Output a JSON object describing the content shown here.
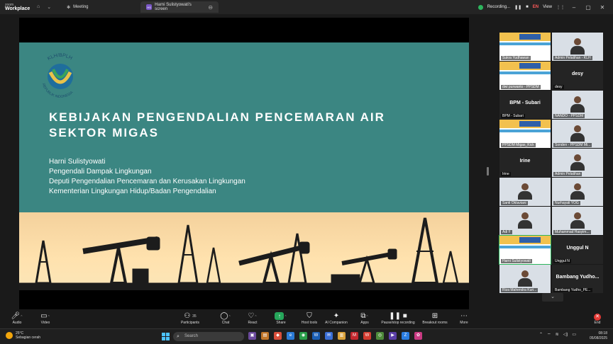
{
  "titlebar": {
    "brand_top": "zoom",
    "brand_bottom": "Workplace",
    "meeting_tab": "Meeting",
    "screen_tab": "Harni Sulistyowati's screen",
    "screen_tab_initials": "HS",
    "recording": "Recording...",
    "lang": "EN",
    "view": "View"
  },
  "slide": {
    "logo_text": "KLH/BPLH",
    "logo_subtext": "REPUBLIK INDONESIA",
    "title_line1": "KEBIJAKAN PENGENDALIAN PENCEMARAN AIR",
    "title_line2": "SEKTOR MIGAS",
    "lines": [
      "Harni Sulistyowati",
      "Pengendali Dampak Lingkungan",
      "Deputi Pengendalian Pencemaran dan Kerusakan Lingkungan",
      "Kementerian Lingkungan Hidup/Badan Pengendalian"
    ]
  },
  "participants": [
    {
      "name": "Sukra Yudhawan"
    },
    {
      "name": "Admin Pelatihan - KLH"
    },
    {
      "name": "dwi purwanto - PPSDM"
    },
    {
      "name": "desy",
      "big": "desy"
    },
    {
      "name": "BPM - Subari",
      "big": "BPM - Subari"
    },
    {
      "name": "NANDO - PPSDM"
    },
    {
      "name": "PPSDM Migas_Kick"
    },
    {
      "name": "Sonden - PPSDM Mi..."
    },
    {
      "name": "Irine",
      "big": "Irine"
    },
    {
      "name": "Admin Pelatihan"
    },
    {
      "name": "Santi Oktaviani"
    },
    {
      "name": "Nurhayati YOG"
    },
    {
      "name": "Adi F"
    },
    {
      "name": "Muhammad Hasyim..."
    },
    {
      "name": "Harni Sulistyowati"
    },
    {
      "name": "Unggul N",
      "big": "Unggul N"
    },
    {
      "name": "Riza Mahendra Kuri..."
    },
    {
      "name": "Bambang Yudho_PE...",
      "big": "Bambang Yudho..."
    }
  ],
  "toolbar": {
    "audio": "Audio",
    "video": "Video",
    "participants": "Participants",
    "participants_count": "35",
    "chat": "Chat",
    "react": "React",
    "share": "Share",
    "host_tools": "Host tools",
    "ai_companion": "AI Companion",
    "apps": "Apps",
    "pause_recording": "Pause/stop recording",
    "breakout": "Breakout rooms",
    "more": "More",
    "end": "End"
  },
  "taskbar": {
    "temp": "25°C",
    "weather": "Sebagian cerah",
    "search_placeholder": "Search",
    "time": "08:18",
    "date": "05/08/2025"
  },
  "colors": {
    "slide_teal": "#3b8682",
    "share_green": "#26a65b",
    "end_red": "#e53935"
  }
}
